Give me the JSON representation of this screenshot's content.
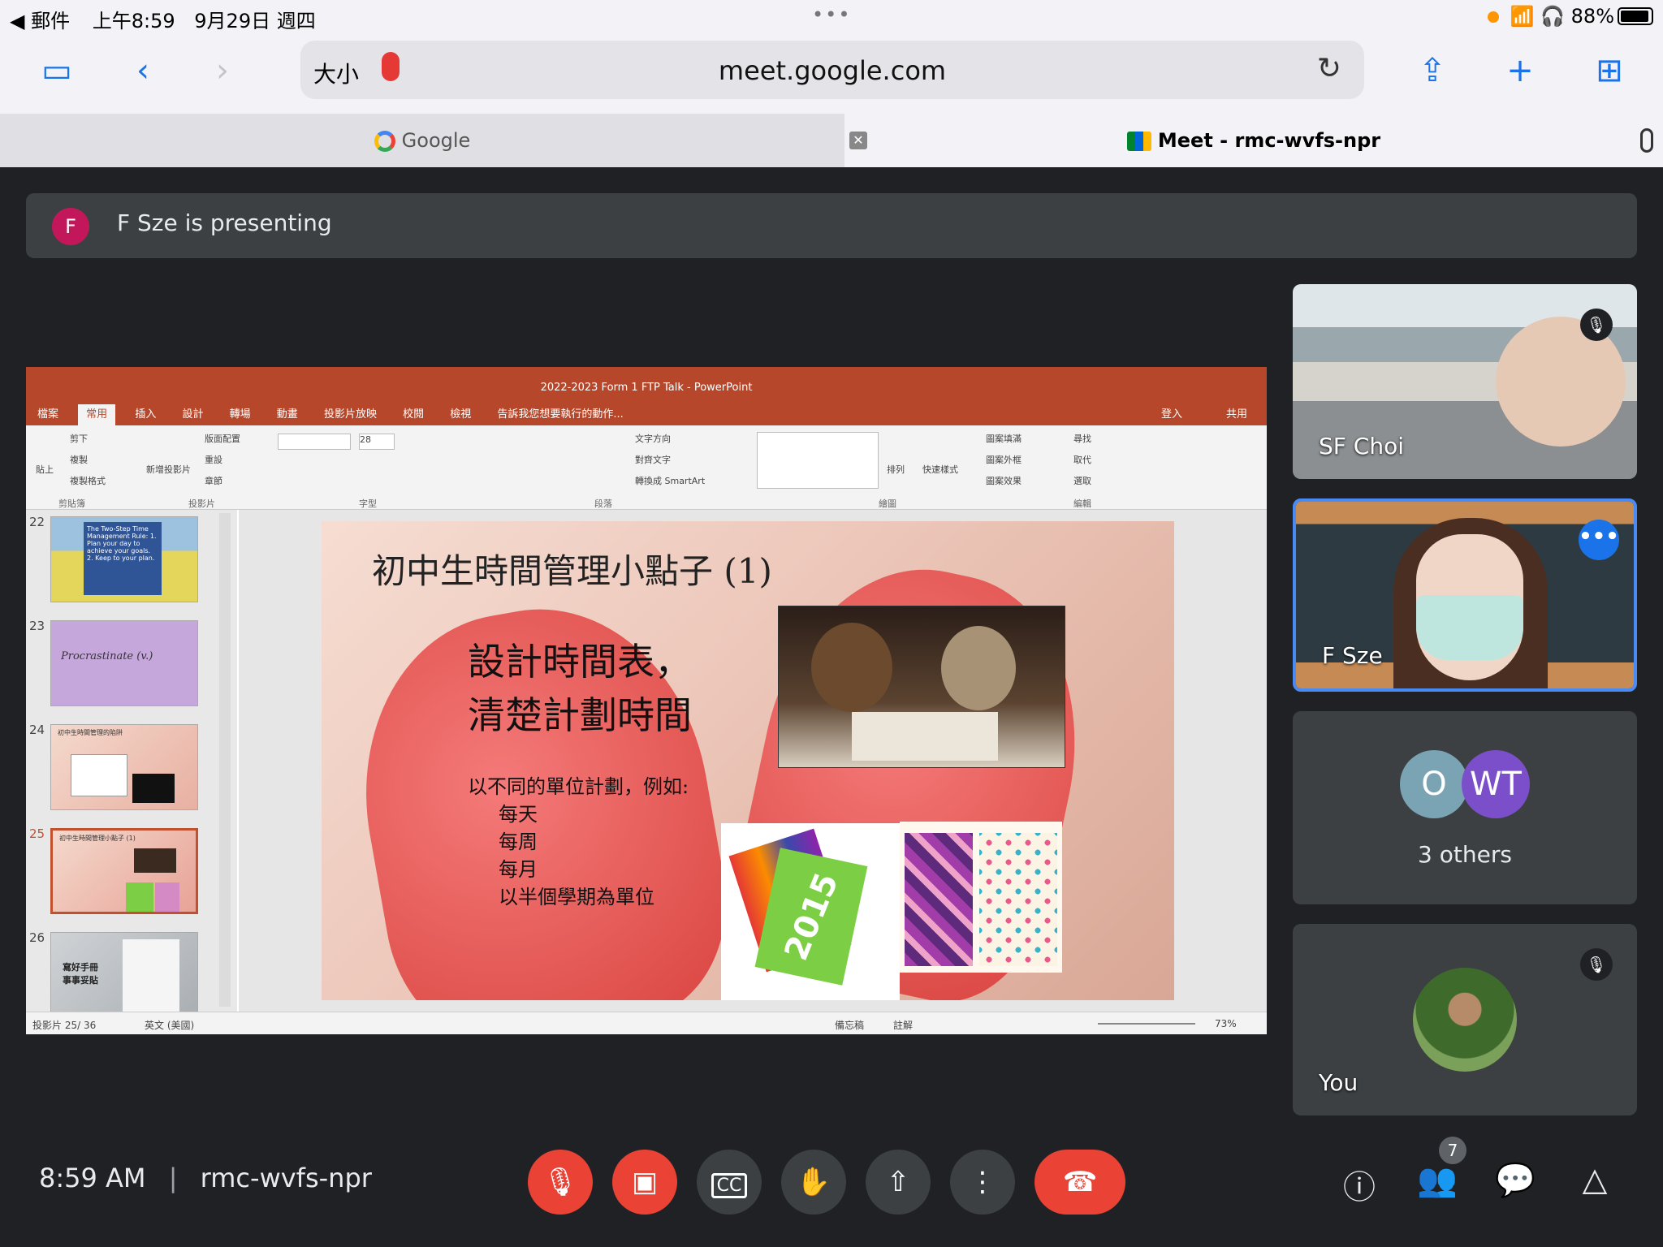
{
  "statusbar": {
    "back_app": "◀ 郵件",
    "time": "上午8:59",
    "date": "9月29日 週四",
    "battery": "88%"
  },
  "safari": {
    "text_size": "大小",
    "url": "meet.google.com",
    "tabs": [
      {
        "label": "Google"
      },
      {
        "label": "Meet - rmc-wvfs-npr"
      }
    ]
  },
  "banner": {
    "avatar": "F",
    "text": "F Sze is presenting"
  },
  "ppt": {
    "window_title": "2022-2023 Form 1 FTP Talk - PowerPoint",
    "menu": [
      "檔案",
      "常用",
      "插入",
      "設計",
      "轉場",
      "動畫",
      "投影片放映",
      "校閱",
      "檢視",
      "告訴我您想要執行的動作..."
    ],
    "login": "登入",
    "share": "共用",
    "ribbon_groups": [
      "剪貼簿",
      "投影片",
      "字型",
      "段落",
      "繪圖",
      "編輯"
    ],
    "ribbon_items": {
      "cut": "剪下",
      "copy": "複製",
      "format": "複製格式",
      "paste": "貼上",
      "new_slide": "新增投影片",
      "layout": "版面配置",
      "reset": "重設",
      "section": "章節",
      "text_dir": "文字方向",
      "align_text": "對齊文字",
      "smartart": "轉換成 SmartArt",
      "arrange": "排列",
      "quick_style": "快速樣式",
      "fill": "圖案填滿",
      "outline": "圖案外框",
      "effect": "圖案效果",
      "find": "尋找",
      "replace": "取代",
      "select": "選取",
      "font_size": "28"
    },
    "thumbs": [
      {
        "num": "22",
        "text": "The Two-Step Time Management Rule: 1. Plan your day to achieve your goals. 2. Keep to your plan."
      },
      {
        "num": "23",
        "text": "Procrastinate (v.)"
      },
      {
        "num": "24",
        "text": "初中生時間管理的陷阱"
      },
      {
        "num": "25",
        "text": "初中生時間管理小點子 (1)"
      },
      {
        "num": "26",
        "text": "寫好手冊 事事妥貼"
      }
    ],
    "slide": {
      "title": "初中生時間管理小點子 (1)",
      "line1": "設計時間表，",
      "line2": "清楚計劃時間",
      "sub": "以不同的單位計劃，例如:",
      "items": [
        "每天",
        "每周",
        "每月",
        "以半個學期為單位"
      ],
      "cal_year": "2015"
    },
    "status": {
      "slide": "投影片 25/ 36",
      "lang": "英文 (美國)",
      "notes": "備忘稿",
      "comments": "註解",
      "zoom": "73%"
    }
  },
  "tiles": {
    "sf": "SF Choi",
    "fsze": "F Sze",
    "others_o": "O",
    "others_wt": "WT",
    "others_label": "3 others",
    "you": "You"
  },
  "bottom": {
    "time": "8:59 AM",
    "code": "rmc-wvfs-npr",
    "people_count": "7"
  }
}
